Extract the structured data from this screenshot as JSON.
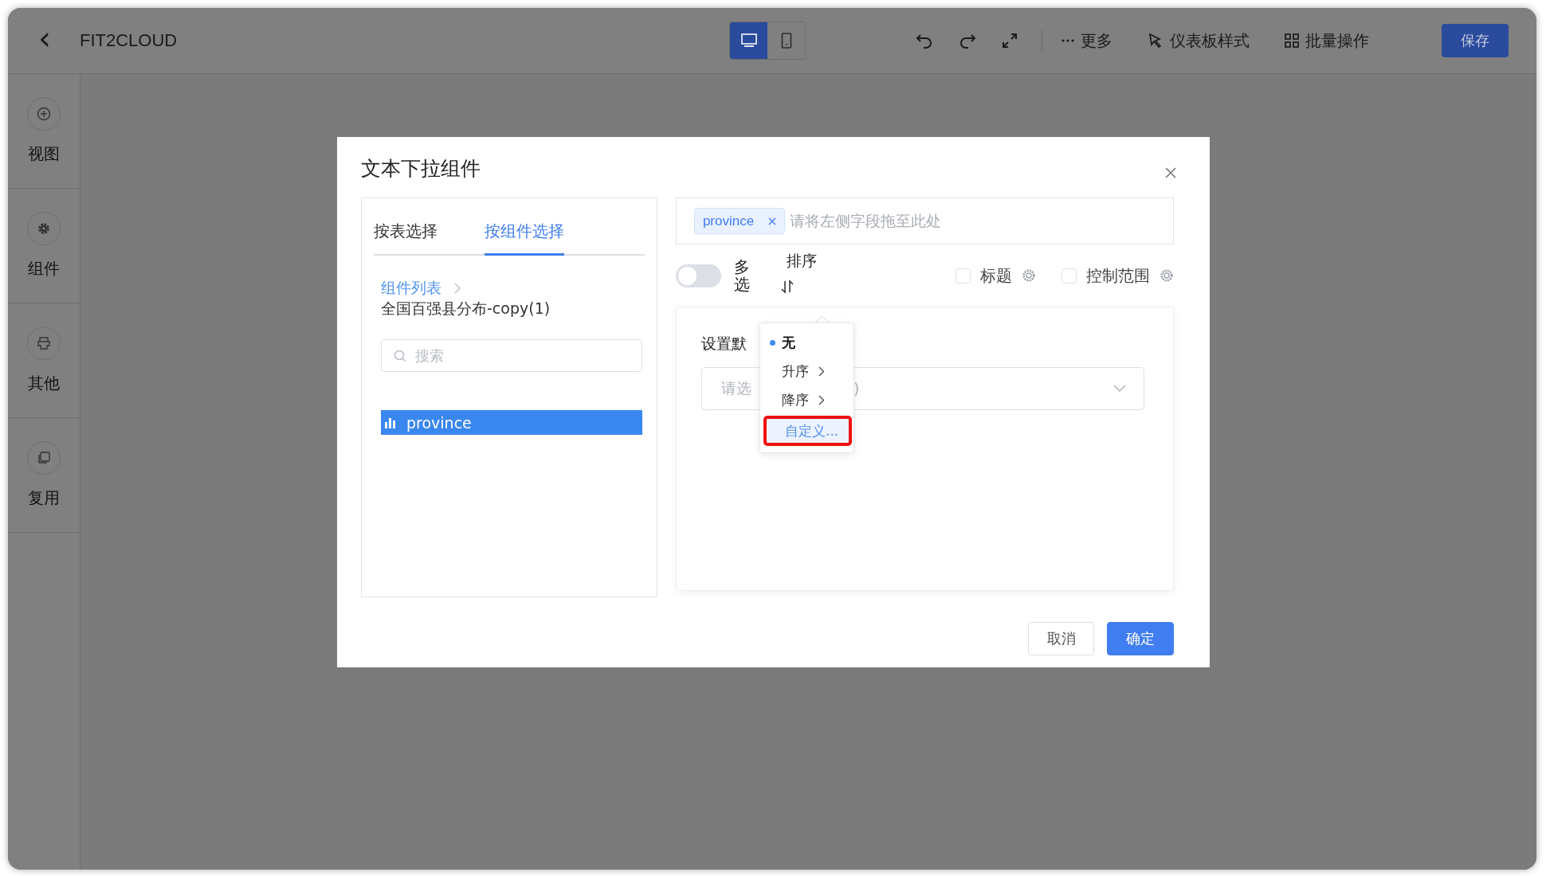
{
  "app": {
    "back": "‹",
    "title": "FIT2CLOUD",
    "view_modes": [
      {
        "kind": "desktop",
        "selected": true
      },
      {
        "kind": "mobile",
        "selected": false
      }
    ],
    "tools": [
      {
        "kind": "undo"
      },
      {
        "kind": "redo"
      },
      {
        "kind": "fullscreen"
      }
    ],
    "actions": [
      {
        "kind": "more",
        "label": "更多"
      },
      {
        "kind": "style",
        "label": "仪表板样式"
      },
      {
        "kind": "batch",
        "label": "批量操作"
      }
    ],
    "save_button": "保存"
  },
  "sidebar": {
    "items": [
      {
        "kind": "add",
        "label": "视图"
      },
      {
        "kind": "gear",
        "label": "组件"
      },
      {
        "kind": "other",
        "label": "其他"
      },
      {
        "kind": "copy",
        "label": "复用"
      }
    ]
  },
  "dialog": {
    "title": "文本下拉组件",
    "tabs": [
      {
        "label": "按表选择",
        "selected": false
      },
      {
        "label": "按组件选择",
        "selected": true
      }
    ],
    "breadcrumb": {
      "link": "组件列表",
      "current": "全国百强县分布-copy(1)"
    },
    "search": {
      "placeholder": "搜索"
    },
    "fields": [
      {
        "label": "province",
        "selected": true
      }
    ],
    "drop_zone": {
      "tags": [
        "province"
      ],
      "placeholder": "请将左侧字段拖至此处"
    },
    "multi_select": {
      "label": "多选",
      "on": false
    },
    "sort": {
      "label": "排序"
    },
    "checkboxes": [
      {
        "label": "标题",
        "checked": false
      },
      {
        "label": "控制范围",
        "checked": false
      }
    ],
    "default_value": {
      "label": "设置默",
      "placeholder": "请选",
      "tail": ")"
    },
    "sort_menu": {
      "items": [
        {
          "label": "无",
          "selected": true,
          "submenu": false,
          "highlighted": false
        },
        {
          "label": "升序",
          "selected": false,
          "submenu": true,
          "highlighted": false
        },
        {
          "label": "降序",
          "selected": false,
          "submenu": true,
          "highlighted": false
        },
        {
          "label": "自定义...",
          "selected": false,
          "submenu": false,
          "highlighted": true
        }
      ]
    },
    "buttons": [
      {
        "kind": "secondary",
        "label": "取消"
      },
      {
        "kind": "primary",
        "label": "确定"
      }
    ]
  }
}
